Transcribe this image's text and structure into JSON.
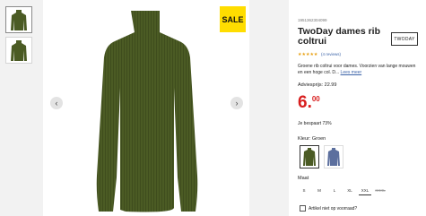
{
  "gallery": {
    "sale_badge": "SALE",
    "prev_icon": "chevron-left-icon",
    "next_icon": "chevron-right-icon",
    "arrow_left": "‹",
    "arrow_right": "›",
    "sweater_color": "#4b5b24"
  },
  "product": {
    "sku": "1951362304099",
    "title": "TwoDay dames rib coltrui",
    "brand_logo": "TWODAY",
    "rating_stars": "★★★★★",
    "reviews": "(4 reviews)",
    "description": "Groene rib coltrui voor dames. Voorzien van lange mouwen en een hoge col. D...",
    "read_more": "Lees meer",
    "advies": "Adviesprijs: 22.99",
    "price_int": "6.",
    "price_dec": "00",
    "savings": "Je bespaart 73%",
    "color_label": "Kleur: Groen",
    "size_label": "Maat",
    "sizes": [
      "S",
      "M",
      "L",
      "XL",
      "XXL",
      "XXXL"
    ],
    "stock_check": "Artikel niet op voorraad?"
  },
  "colors": {
    "sale": "#ffdd00",
    "price": "#d81e1e",
    "link": "#3b63a8",
    "green": "#4b5b24",
    "blue": "#5c6f9e"
  }
}
